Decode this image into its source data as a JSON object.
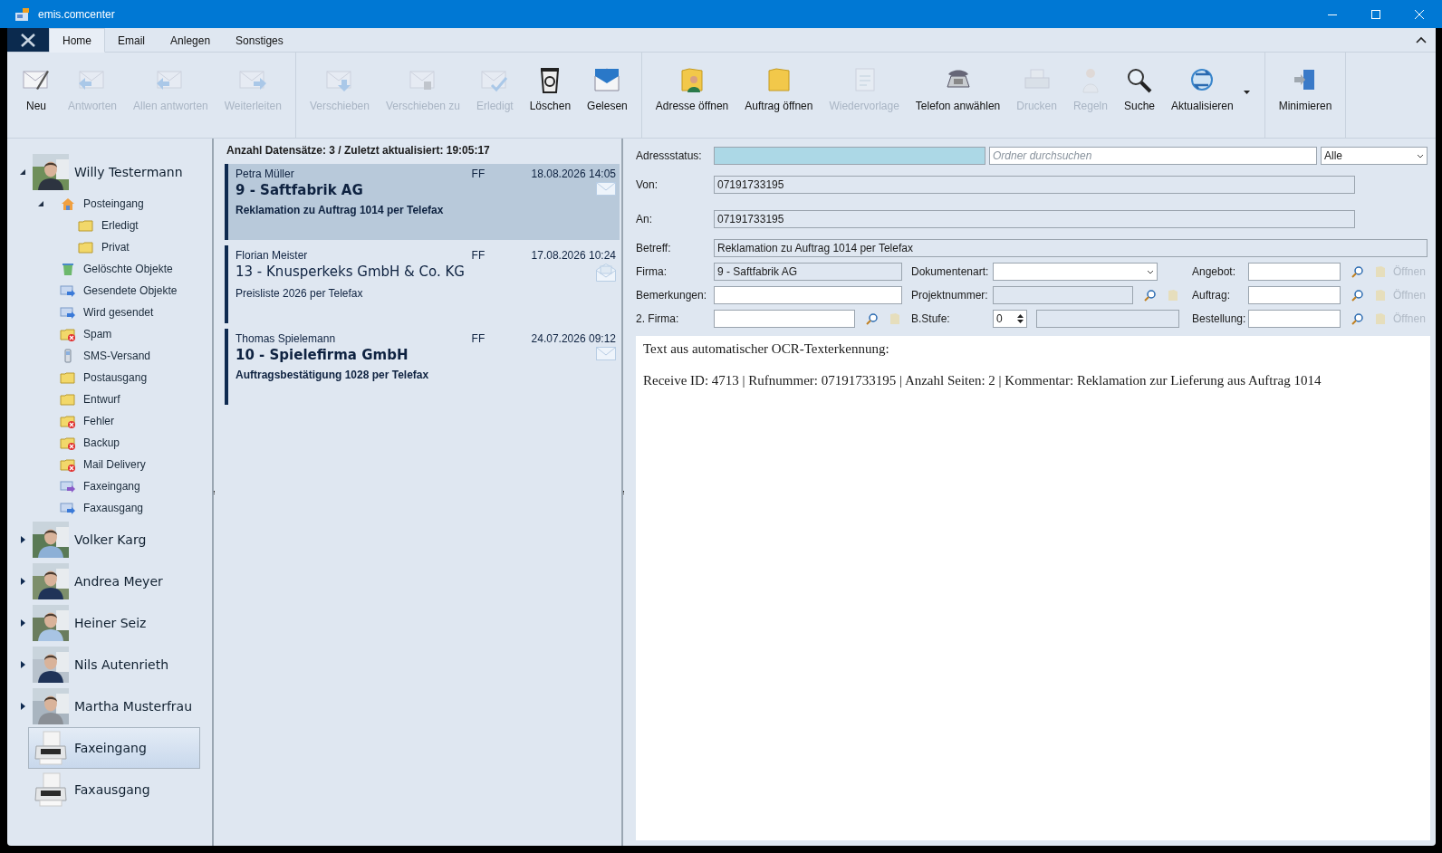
{
  "window": {
    "title": "emis.comcenter"
  },
  "ribbon": {
    "tabs": [
      {
        "label": "Home",
        "selected": true
      },
      {
        "label": "Email",
        "selected": false
      },
      {
        "label": "Anlegen",
        "selected": false
      },
      {
        "label": "Sonstiges",
        "selected": false
      }
    ],
    "groups": [
      [
        {
          "label": "Neu",
          "disabled": false
        },
        {
          "label": "Antworten",
          "disabled": true
        },
        {
          "label": "Allen antworten",
          "disabled": true
        },
        {
          "label": "Weiterleiten",
          "disabled": true
        }
      ],
      [
        {
          "label": "Verschieben",
          "disabled": true
        },
        {
          "label": "Verschieben zu",
          "disabled": true
        },
        {
          "label": "Erledigt",
          "disabled": true
        },
        {
          "label": "Löschen",
          "disabled": false
        },
        {
          "label": "Gelesen",
          "disabled": false
        }
      ],
      [
        {
          "label": "Adresse öffnen",
          "disabled": false
        },
        {
          "label": "Auftrag öffnen",
          "disabled": false
        },
        {
          "label": "Wiedervorlage",
          "disabled": true
        },
        {
          "label": "Telefon anwählen",
          "disabled": false
        },
        {
          "label": "Drucken",
          "disabled": true
        },
        {
          "label": "Regeln",
          "disabled": true
        },
        {
          "label": "Suche",
          "disabled": false
        },
        {
          "label": "Aktualisieren",
          "disabled": false
        }
      ],
      [
        {
          "label": "Minimieren",
          "disabled": false
        }
      ]
    ]
  },
  "tree": [
    {
      "label": "Willy Testermann",
      "kind": "account",
      "expanded": true,
      "selected": false,
      "children": [
        {
          "label": "Posteingang",
          "expanded": true,
          "selected": false,
          "children": [
            {
              "label": "Erledigt",
              "selected": false
            },
            {
              "label": "Privat",
              "selected": false
            }
          ]
        },
        {
          "label": "Gelöschte Objekte",
          "selected": false
        },
        {
          "label": "Gesendete Objekte",
          "selected": false
        },
        {
          "label": "Wird gesendet",
          "selected": false
        },
        {
          "label": "Spam",
          "selected": false
        },
        {
          "label": "SMS-Versand",
          "selected": false
        },
        {
          "label": "Postausgang",
          "selected": false
        },
        {
          "label": "Entwurf",
          "selected": false
        },
        {
          "label": "Fehler",
          "selected": false
        },
        {
          "label": "Backup",
          "selected": false
        },
        {
          "label": "Mail Delivery",
          "selected": false
        },
        {
          "label": "Faxeingang",
          "selected": false
        },
        {
          "label": "Faxausgang",
          "selected": false
        }
      ]
    },
    {
      "label": "Volker Karg",
      "kind": "account",
      "expanded": false,
      "selected": false
    },
    {
      "label": "Andrea Meyer",
      "kind": "account",
      "expanded": false,
      "selected": false
    },
    {
      "label": "Heiner Seiz",
      "kind": "account",
      "expanded": false,
      "selected": false
    },
    {
      "label": "Nils Autenrieth",
      "kind": "account",
      "expanded": false,
      "selected": false
    },
    {
      "label": "Martha Musterfrau",
      "kind": "account",
      "expanded": false,
      "selected": false
    },
    {
      "label": "Faxeingang",
      "kind": "fax",
      "selected": true
    },
    {
      "label": "Faxausgang",
      "kind": "fax",
      "selected": false
    }
  ],
  "list": {
    "header": "Anzahl Datensätze: 3 / Zuletzt aktualisiert: 19:05:17",
    "items": [
      {
        "sender": "Petra Müller",
        "channel": "FF",
        "date": "18.08.2026 14:05",
        "title": "9 - Saftfabrik AG",
        "subject": "Reklamation zu Auftrag 1014 per Telefax",
        "selected": true,
        "unread": true
      },
      {
        "sender": "Florian Meister",
        "channel": "FF",
        "date": "17.08.2026 10:24",
        "title": "13 - Knusperkeks GmbH & Co. KG",
        "subject": "Preisliste 2026 per Telefax",
        "selected": false,
        "unread": false
      },
      {
        "sender": "Thomas Spielemann",
        "channel": "FF",
        "date": "24.07.2026 09:12",
        "title": "10 - Spielefirma GmbH",
        "subject": "Auftragsbestätigung 1028 per Telefax",
        "selected": false,
        "unread": true
      }
    ]
  },
  "detail": {
    "address_status": {
      "label": "Adressstatus:"
    },
    "search": {
      "placeholder": "Ordner durchsuchen"
    },
    "filter": {
      "value": "Alle"
    },
    "von": {
      "label": "Von:",
      "value": "07191733195"
    },
    "an": {
      "label": "An:",
      "value": "07191733195"
    },
    "betreff": {
      "label": "Betreff:",
      "value": "Reklamation zu Auftrag 1014 per Telefax"
    },
    "rows": [
      [
        {
          "label": "Firma:",
          "kind": "text",
          "value": "9 - Saftfabrik AG",
          "disabled": true
        },
        {
          "label": "Dokumentenart:",
          "kind": "select",
          "disabled": false
        },
        {
          "label": "Angebot:",
          "kind": "lookup",
          "open": {
            "label": "Öffnen",
            "disabled": true
          }
        }
      ],
      [
        {
          "label": "Bemerkungen:",
          "kind": "text",
          "disabled": false
        },
        {
          "label": "Projektnummer:",
          "kind": "search",
          "disabled": true
        },
        {
          "label": "Auftrag:",
          "kind": "lookup",
          "open": {
            "label": "Öffnen",
            "disabled": true
          }
        }
      ],
      [
        {
          "label": "2. Firma:",
          "kind": "search",
          "disabled": false
        },
        {
          "label": "B.Stufe:",
          "kind": "spin",
          "value": "0"
        },
        {
          "label": "Bestellung:",
          "kind": "lookup",
          "open": {
            "label": "Öffnen",
            "disabled": true
          }
        }
      ]
    ],
    "body": [
      "Text aus automatischer OCR-Texterkennung:",
      "Receive ID: 4713 | Rufnummer: 07191733195 | Anzahl Seiten: 2 | Kommentar: Reklamation zur Lieferung aus Auftrag 1014"
    ]
  }
}
